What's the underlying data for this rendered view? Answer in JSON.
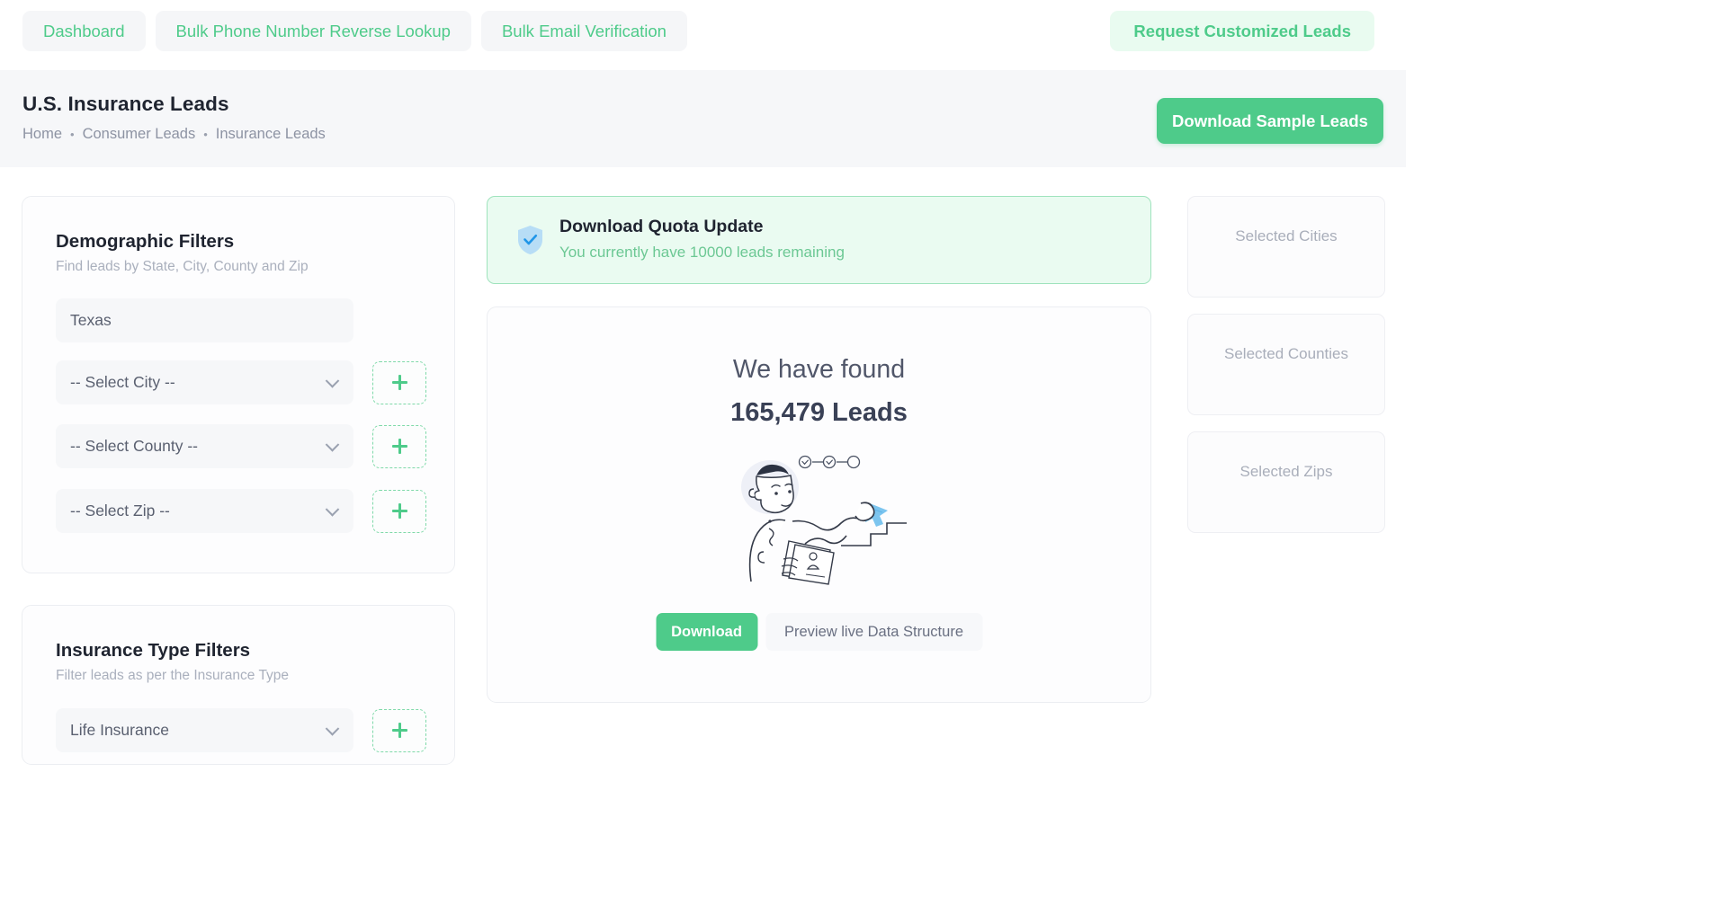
{
  "topnav": {
    "items": [
      {
        "label": "Dashboard",
        "name": "nav-dashboard"
      },
      {
        "label": "Bulk Phone Number Reverse Lookup",
        "name": "nav-bulk-phone-lookup"
      },
      {
        "label": "Bulk Email Verification",
        "name": "nav-bulk-email-verification"
      }
    ],
    "cta": "Request Customized Leads"
  },
  "header": {
    "title": "U.S. Insurance Leads",
    "breadcrumb": [
      "Home",
      "Consumer Leads",
      "Insurance Leads"
    ],
    "crumb_separator": "•",
    "download_sample_label": "Download Sample Leads"
  },
  "demographic": {
    "title": "Demographic Filters",
    "subtitle": "Find leads by State, City, County and Zip",
    "state_value": "Texas",
    "fields": [
      {
        "label": "-- Select City --",
        "name": "select-city"
      },
      {
        "label": "-- Select County --",
        "name": "select-county"
      },
      {
        "label": "-- Select Zip --",
        "name": "select-zip"
      }
    ]
  },
  "insurance": {
    "title": "Insurance Type Filters",
    "subtitle": "Filter leads as per the Insurance Type",
    "selected": "Life Insurance"
  },
  "quota": {
    "title": "Download Quota Update",
    "message": "You currently have 10000 leads remaining",
    "icon": "shield-check-icon"
  },
  "result": {
    "found_label": "We have found",
    "count_label": "165,479 Leads",
    "download_label": "Download",
    "preview_label": "Preview live Data Structure"
  },
  "selected_panels": [
    {
      "label": "Selected Cities",
      "name": "panel-selected-cities"
    },
    {
      "label": "Selected Counties",
      "name": "panel-selected-counties"
    },
    {
      "label": "Selected Zips",
      "name": "panel-selected-zips"
    }
  ],
  "colors": {
    "accent_green": "#4ecb8a",
    "accent_green_soft": "#e9fbf0",
    "banner_bg": "#eafbf1",
    "banner_border": "#9fe3bd",
    "header_band": "#f6f7f9",
    "text_dark": "#1f2430",
    "text_muted": "#8d93a3",
    "shield_blue": "#b3dcf7"
  }
}
